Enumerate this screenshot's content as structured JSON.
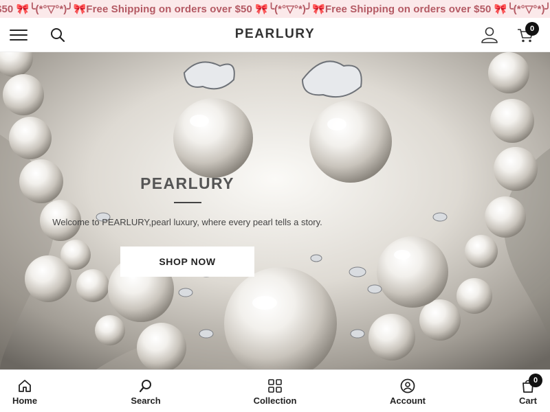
{
  "announcement": {
    "text": "$50 🎀╰(*°▽°*)╯🎀Free Shipping on orders over $50 🎀╰(*°▽°*)╯🎀Free Shipping on orders over $50 🎀╰(*°▽°*)╯🎀Free"
  },
  "header": {
    "brand": "PEARLURY",
    "cart_count": "0",
    "icons": [
      "menu-icon",
      "search-icon",
      "account-icon",
      "cart-icon"
    ]
  },
  "hero": {
    "title": "PEARLURY",
    "subtitle": "Welcome to PEARLURY,pearl luxury, where every pearl tells a story.",
    "cta_label": "SHOP NOW"
  },
  "bottom_nav": {
    "items": [
      {
        "label": "Home",
        "icon": "home-icon"
      },
      {
        "label": "Search",
        "icon": "search-icon"
      },
      {
        "label": "Collection",
        "icon": "grid-icon"
      },
      {
        "label": "Account",
        "icon": "account-icon"
      },
      {
        "label": "Cart",
        "icon": "cart-icon"
      }
    ],
    "cart_count": "0"
  },
  "colors": {
    "announcement_bg": "#fbe9ea",
    "announcement_text": "#b45a64",
    "badge": "#111111"
  }
}
